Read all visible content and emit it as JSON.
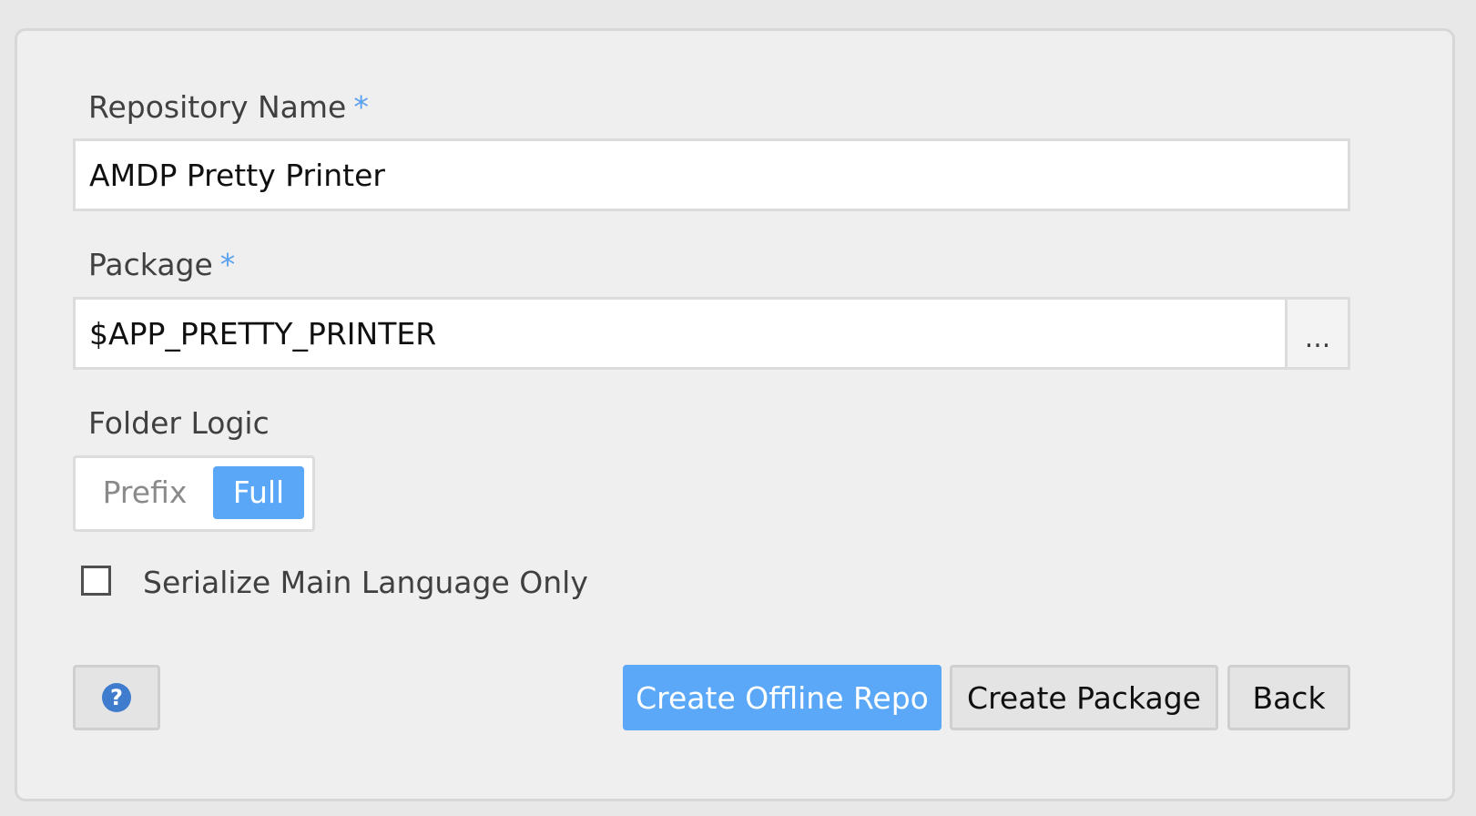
{
  "form": {
    "repo_name": {
      "label": "Repository Name",
      "required_mark": "*",
      "value": "AMDP Pretty Printer"
    },
    "package": {
      "label": "Package",
      "required_mark": "*",
      "value": "$APP_PRETTY_PRINTER",
      "browse_label": "..."
    },
    "folder_logic": {
      "label": "Folder Logic",
      "options": [
        "Prefix",
        "Full"
      ],
      "selected": "Full"
    },
    "serialize": {
      "label": "Serialize Main Language Only",
      "checked": false
    }
  },
  "footer": {
    "help_icon": "question-circle-icon",
    "help_glyph": "?",
    "create_offline_label": "Create Offline Repo",
    "create_package_label": "Create Package",
    "back_label": "Back"
  },
  "colors": {
    "accent": "#5ba8f8",
    "required": "#5aa0f0",
    "help_icon": "#3f7ccd"
  }
}
